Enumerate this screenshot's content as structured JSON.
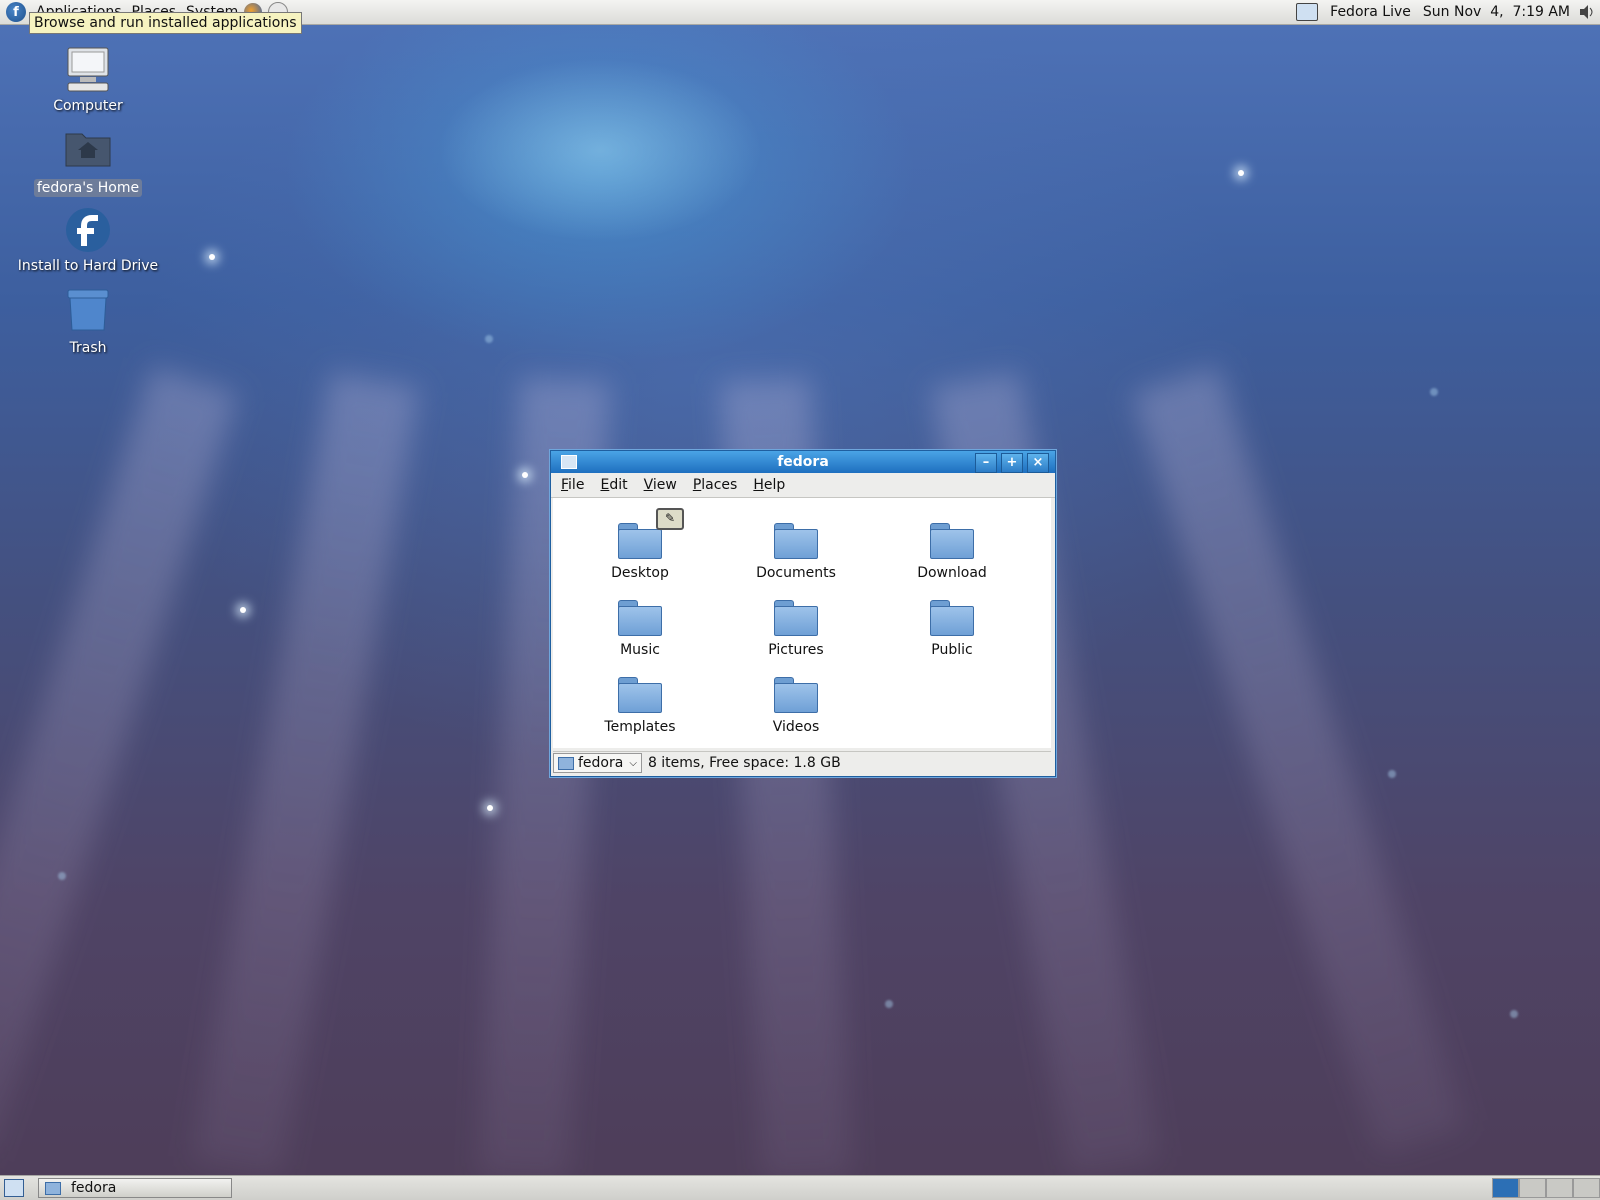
{
  "top_panel": {
    "menus": [
      "Applications",
      "Places",
      "System"
    ],
    "status_user": "Fedora Live",
    "datetime": "Sun Nov  4,  7:19 AM"
  },
  "tooltip": "Browse and run installed applications",
  "desktop_icons": [
    {
      "label": "Computer",
      "icon": "computer-icon"
    },
    {
      "label": "fedora's Home",
      "icon": "home-folder-icon",
      "selected": true
    },
    {
      "label": "Install to Hard Drive",
      "icon": "fedora-logo-icon"
    },
    {
      "label": "Trash",
      "icon": "trash-icon"
    }
  ],
  "window": {
    "title": "fedora",
    "menu": [
      "File",
      "Edit",
      "View",
      "Places",
      "Help"
    ],
    "folders": [
      "Desktop",
      "Documents",
      "Download",
      "Music",
      "Pictures",
      "Public",
      "Templates",
      "Videos"
    ],
    "location": "fedora",
    "status": "8 items, Free space: 1.8 GB"
  },
  "taskbar": {
    "task_label": "fedora"
  }
}
